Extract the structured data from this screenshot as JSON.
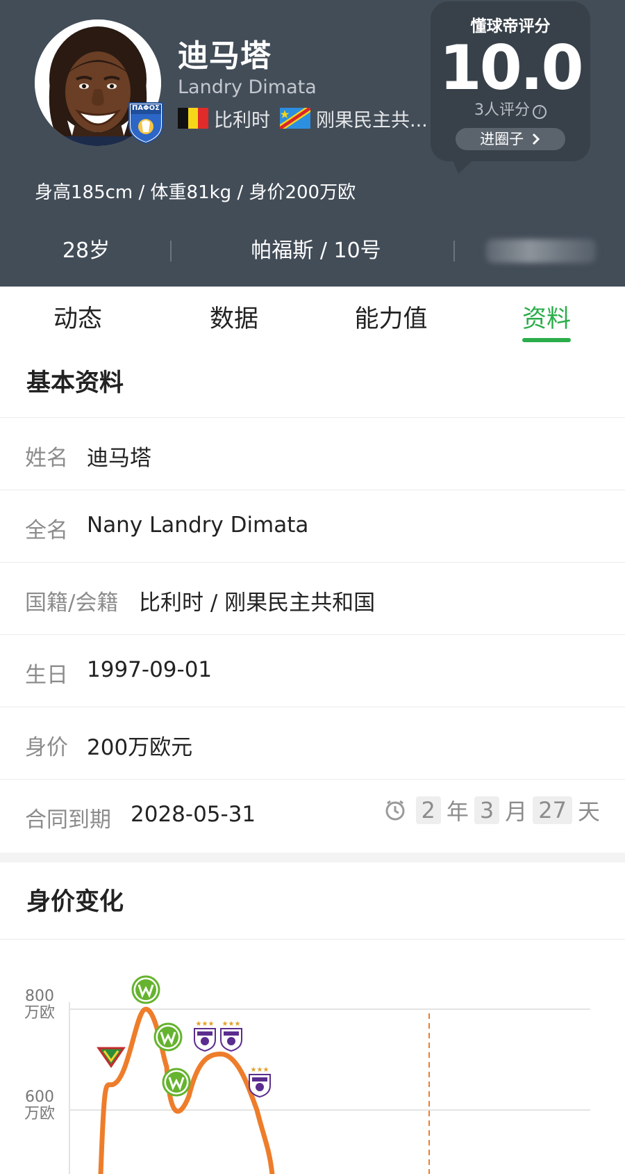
{
  "header": {
    "player_name": "迪马塔",
    "player_name_en": "Landry Dimata",
    "nationality_1": "比利时",
    "nationality_2": "刚果民主共...",
    "body_stats": "身高185cm / 体重81kg / 身价200万欧",
    "age": "28岁",
    "club_number": "帕福斯 / 10号",
    "club_badge_text": "ΠΑΦΟΣ",
    "rating": {
      "title": "懂球帝评分",
      "score": "10.0",
      "count": "3人评分",
      "info_symbol": "i",
      "button_label": "进圈子"
    }
  },
  "tabs": [
    {
      "label": "动态"
    },
    {
      "label": "数据"
    },
    {
      "label": "能力值"
    },
    {
      "label": "资料",
      "active": true
    }
  ],
  "basic_info": {
    "title": "基本资料",
    "rows": [
      {
        "label": "姓名",
        "value": "迪马塔"
      },
      {
        "label": "全名",
        "value": "Nany Landry Dimata"
      },
      {
        "label": "国籍/会籍",
        "value": "比利时 / 刚果民主共和国"
      },
      {
        "label": "生日",
        "value": "1997-09-01"
      },
      {
        "label": "身价",
        "value": "200万欧元"
      },
      {
        "label": "合同到期",
        "value": "2028-05-31"
      }
    ],
    "contract_countdown": {
      "years": "2",
      "year_unit": "年",
      "months": "3",
      "month_unit": "月",
      "days": "27",
      "day_unit": "天"
    }
  },
  "market_value": {
    "title": "身价变化"
  },
  "chart_data": {
    "type": "line",
    "yticks": [
      {
        "value": 800,
        "unit": "万欧"
      },
      {
        "value": 600,
        "unit": "万欧"
      }
    ],
    "ylim": [
      400,
      800
    ],
    "grid": true,
    "points": [
      {
        "x": 1,
        "y": 650,
        "club": "KV Oostende"
      },
      {
        "x": 2,
        "y": 800,
        "club": "VfL Wolfsburg"
      },
      {
        "x": 3,
        "y": 700,
        "club": "VfL Wolfsburg"
      },
      {
        "x": 4,
        "y": 600,
        "club": "VfL Wolfsburg"
      },
      {
        "x": 5,
        "y": 700,
        "club": "RSC Anderlecht"
      },
      {
        "x": 6,
        "y": 700,
        "club": "RSC Anderlecht"
      },
      {
        "x": 7,
        "y": 600,
        "club": "RSC Anderlecht"
      }
    ],
    "colors": {
      "line": "#ee7d2b",
      "grid": "#e3e3e3",
      "marker_line": "#ee7d2b",
      "wolfsburg": "#65b32e",
      "anderlecht": "#5b2d8e",
      "ostende": "#2b8d3a"
    }
  },
  "colors": {
    "header_bg": "#434d58",
    "accent": "#2bad4a"
  }
}
